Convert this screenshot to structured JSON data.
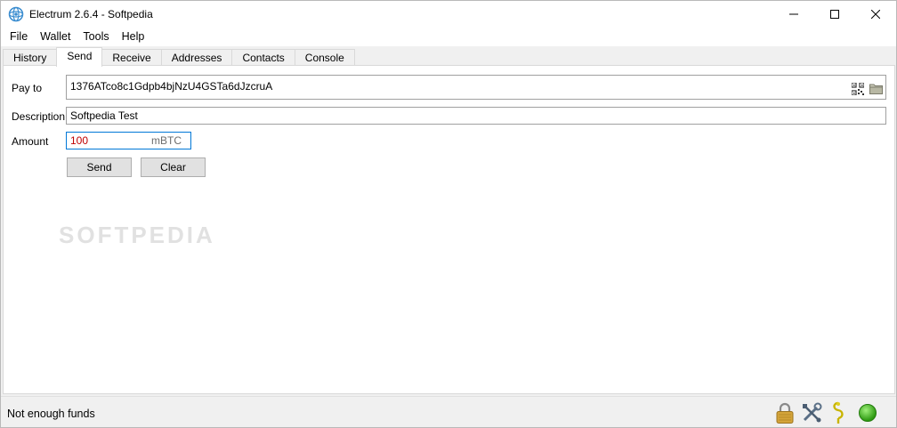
{
  "window": {
    "title": "Electrum 2.6.4  -  Softpedia",
    "icons": {
      "app": "electrum-icon",
      "minimize": "minimize-icon",
      "maximize": "maximize-icon",
      "close": "close-icon"
    }
  },
  "menu": {
    "items": [
      "File",
      "Wallet",
      "Tools",
      "Help"
    ]
  },
  "tabs": {
    "items": [
      "History",
      "Send",
      "Receive",
      "Addresses",
      "Contacts",
      "Console"
    ],
    "active": "Send"
  },
  "send": {
    "pay_to_label": "Pay to",
    "pay_to_value": "1376ATco8c1Gdpb4bjNzU4GSTa6dJzcruA",
    "description_label": "Description",
    "description_value": "Softpedia Test",
    "amount_label": "Amount",
    "amount_value": "100",
    "amount_unit": "mBTC",
    "send_button": "Send",
    "clear_button": "Clear",
    "watermark": "SOFTPEDIA",
    "icons": {
      "qr": "qr-code-icon",
      "folder": "folder-icon"
    }
  },
  "status": {
    "text": "Not enough funds",
    "icons": [
      "lock-icon",
      "tools-icon",
      "seed-icon",
      "network-status-icon"
    ],
    "colors": {
      "network": "#3fbf1f",
      "lock": "#d4a43a"
    }
  }
}
